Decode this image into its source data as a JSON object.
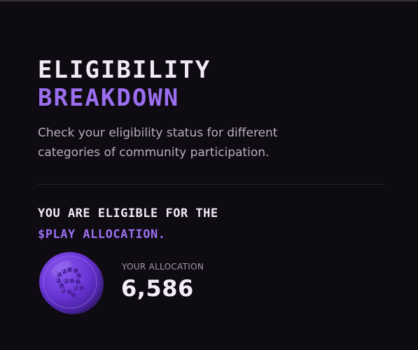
{
  "header": {
    "title_line1": "ELIGIBILITY",
    "title_line2": "BREAKDOWN",
    "subtitle": "Check your eligibility status for different categories of community participation."
  },
  "eligibility": {
    "line1": "YOU ARE ELIGIBLE FOR THE",
    "line2": "$PLAY ALLOCATION."
  },
  "allocation": {
    "label": "YOUR ALLOCATION",
    "value": "6,586",
    "icon": "play-coin-icon"
  },
  "colors": {
    "background": "#0e0b12",
    "accent": "#9b6ff0",
    "text_primary": "#f2eaf6",
    "text_secondary": "#b9b0bf"
  }
}
